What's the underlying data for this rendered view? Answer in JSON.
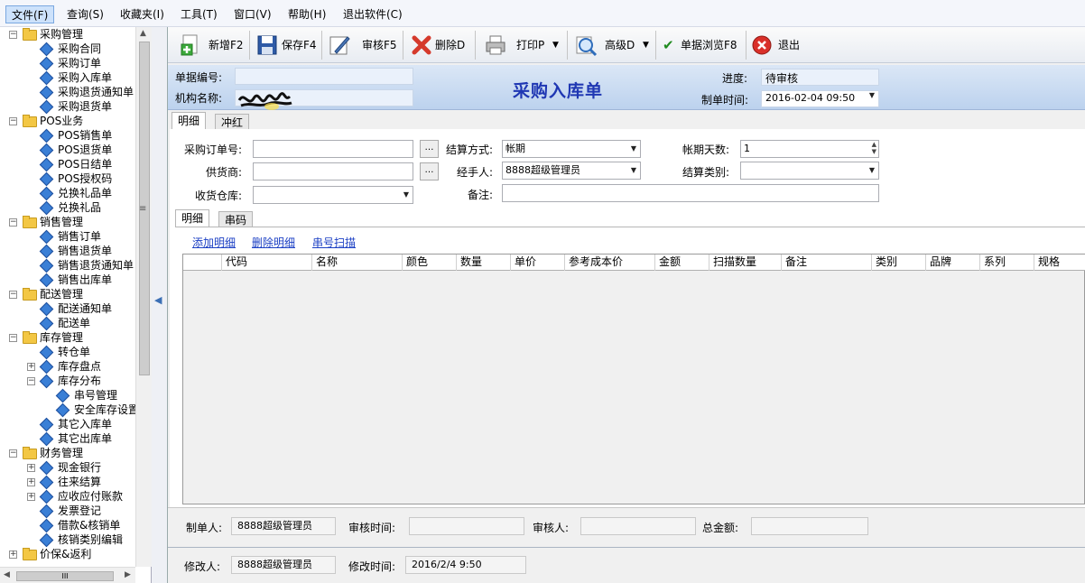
{
  "menu": {
    "file": "文件(F)",
    "query": "查询(S)",
    "favorites": "收藏夹(I)",
    "tools": "工具(T)",
    "window": "窗口(V)",
    "help": "帮助(H)",
    "exit": "退出软件(C)"
  },
  "tree": {
    "purchase": "采购管理",
    "purchase_contract": "采购合同",
    "purchase_order": "采购订单",
    "purchase_inbound": "采购入库单",
    "purchase_return_notice": "采购退货通知单",
    "purchase_return": "采购退货单",
    "pos": "POS业务",
    "pos_sale": "POS销售单",
    "pos_return": "POS退货单",
    "pos_daily": "POS日结单",
    "pos_auth": "POS授权码",
    "gift_exchange_order": "兑换礼品单",
    "gift_exchange": "兑换礼品",
    "sales": "销售管理",
    "sales_order": "销售订单",
    "sales_return": "销售退货单",
    "sales_return_notice": "销售退货通知单",
    "sales_outbound": "销售出库单",
    "delivery": "配送管理",
    "delivery_notice": "配送通知单",
    "delivery_order": "配送单",
    "inventory": "库存管理",
    "transfer": "转仓单",
    "stocktake": "库存盘点",
    "stock_dist": "库存分布",
    "serial_mgmt": "串号管理",
    "safety_stock": "安全库存设置",
    "other_in": "其它入库单",
    "other_out": "其它出库单",
    "finance": "财务管理",
    "cash_bank": "现金银行",
    "settlement": "往来结算",
    "ar_ap": "应收应付账款",
    "invoice": "发票登记",
    "loan": "借款&核销单",
    "writeoff_type": "核销类别编辑",
    "price_rebate": "价保&返利"
  },
  "toolbar": {
    "new": "新增F2",
    "save": "保存F4",
    "review": "审核F5",
    "delete": "删除D",
    "print": "打印P",
    "advanced": "高级D",
    "browse": "单据浏览F8",
    "exit": "退出"
  },
  "header": {
    "doc_no_label": "单据编号:",
    "doc_no": "",
    "org_label": "机构名称:",
    "title": "采购入库单",
    "progress_label": "进度:",
    "progress": "待审核",
    "time_label": "制单时间:",
    "time": "2016-02-04 09:50"
  },
  "tabs": {
    "detail": "明细",
    "reverse": "冲红"
  },
  "form": {
    "po_label": "采购订单号:",
    "po": "",
    "settle_method_label": "结算方式:",
    "settle_method": "帐期",
    "term_days_label": "帐期天数:",
    "term_days": "1",
    "supplier_label": "供货商:",
    "supplier": "",
    "handler_label": "经手人:",
    "handler": "8888超级管理员",
    "settle_type_label": "结算类别:",
    "settle_type": "",
    "warehouse_label": "收货仓库:",
    "warehouse": "",
    "remark_label": "备注:",
    "remark": ""
  },
  "subtabs": {
    "detail": "明细",
    "serial": "串码"
  },
  "actions": {
    "add": "添加明细",
    "remove": "删除明细",
    "scan": "串号扫描"
  },
  "columns": {
    "code": "代码",
    "name": "名称",
    "color": "颜色",
    "qty": "数量",
    "price": "单价",
    "ref_cost": "参考成本价",
    "amount": "金额",
    "scan_qty": "扫描数量",
    "remark": "备注",
    "category": "类别",
    "brand": "品牌",
    "series": "系列",
    "spec": "规格"
  },
  "footer": {
    "creator_label": "制单人:",
    "creator": "8888超级管理员",
    "review_time_label": "审核时间:",
    "review_time": "",
    "reviewer_label": "审核人:",
    "reviewer": "",
    "total_label": "总金额:",
    "total": "",
    "modifier_label": "修改人:",
    "modifier": "8888超级管理员",
    "modify_time_label": "修改时间:",
    "modify_time": "2016/2/4 9:50"
  },
  "scroll": {
    "hthumb": "III"
  }
}
